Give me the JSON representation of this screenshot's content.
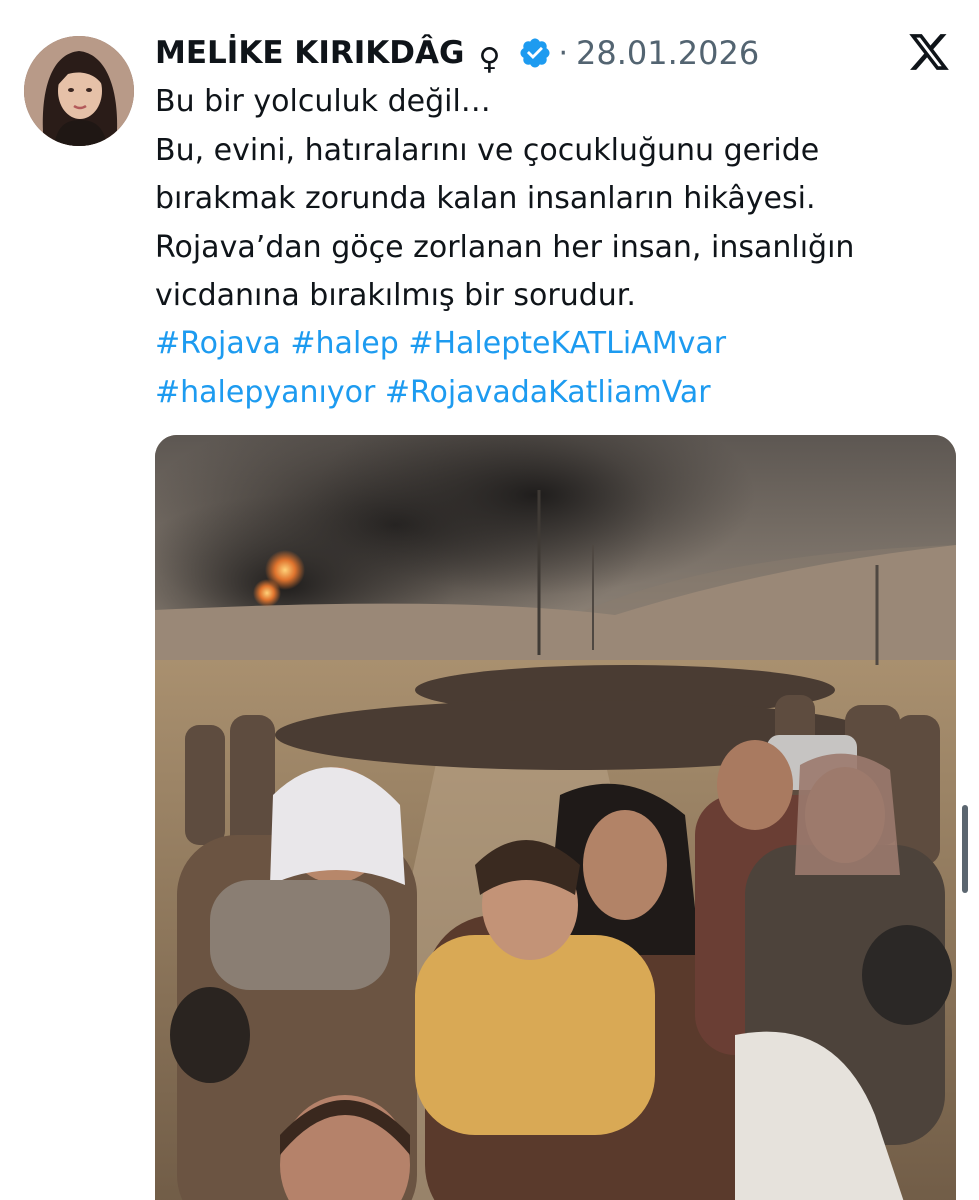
{
  "author": {
    "display_name": "MELİKE KIRIKDÂG",
    "gender_symbol": "♀",
    "verified_icon": "verified-badge-icon",
    "date_separator": "·",
    "date": "28.01.2026"
  },
  "platform_icon": "x-logo-icon",
  "tweet": {
    "lines": [
      "Bu bir yolculuk değil…",
      "Bu, evini, hatıralarını ve çocukluğunu geride",
      "bırakmak zorunda kalan insanların hikâyesi.",
      "Rojava’dan göçe zorlanan her insan, insanlığın",
      "vicdanına bırakılmış bir sorudur."
    ],
    "hashtags_line1": [
      "#Rojava",
      "#halep",
      "#HalepteKATLiAMvar"
    ],
    "hashtags_line2": [
      "#halepyanıyor",
      "#RojavadaKatliamVar"
    ]
  },
  "colors": {
    "text": "#0f1419",
    "secondary": "#536471",
    "hashtag": "#1d9bf0",
    "verified": "#1d9bf0"
  }
}
